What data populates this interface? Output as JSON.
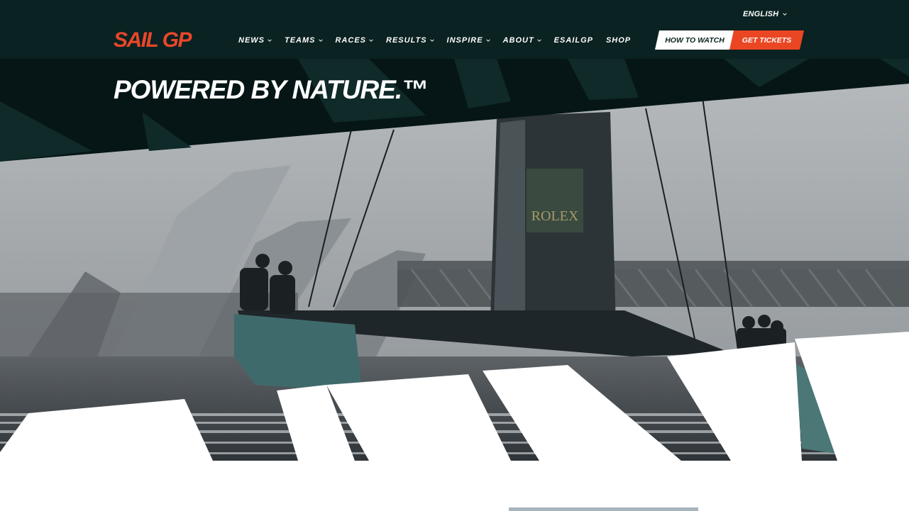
{
  "header": {
    "language": "ENGLISH",
    "logo": "SAIL GP",
    "nav": [
      {
        "label": "NEWS",
        "dropdown": true
      },
      {
        "label": "TEAMS",
        "dropdown": true
      },
      {
        "label": "RACES",
        "dropdown": true
      },
      {
        "label": "RESULTS",
        "dropdown": true
      },
      {
        "label": "INSPIRE",
        "dropdown": true
      },
      {
        "label": "ABOUT",
        "dropdown": true
      },
      {
        "label": "ESAILGP",
        "dropdown": false
      },
      {
        "label": "SHOP",
        "dropdown": false
      }
    ],
    "how_to_watch": "HOW TO WATCH",
    "get_tickets": "GET TICKETS"
  },
  "hero": {
    "headline": "POWERED BY NATURE.™",
    "sail_text": "ROLEX"
  },
  "colors": {
    "header_bg": "#0a2221",
    "accent": "#ea4623",
    "white": "#ffffff"
  },
  "icons": {
    "chevron": "chevron-down-icon"
  }
}
